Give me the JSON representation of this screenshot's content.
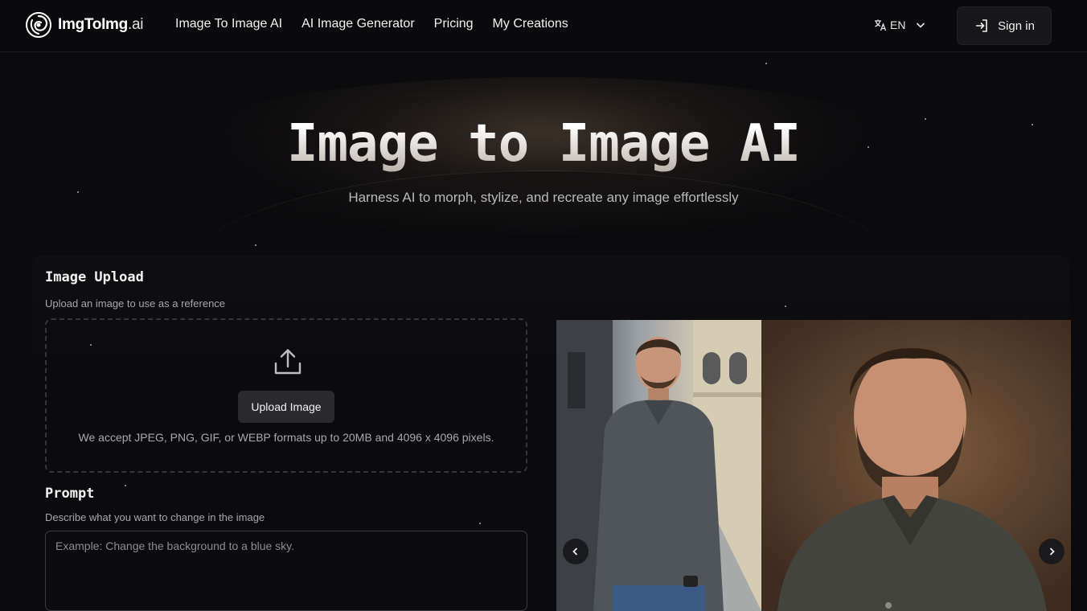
{
  "header": {
    "logo_name": "ImgToImg",
    "logo_tld": ".ai",
    "nav": [
      {
        "label": "Image To Image AI"
      },
      {
        "label": "AI Image Generator"
      },
      {
        "label": "Pricing"
      },
      {
        "label": "My Creations"
      }
    ],
    "language": "EN",
    "signin_label": "Sign in"
  },
  "hero": {
    "title": "Image to Image AI",
    "subtitle": "Harness AI to morph, stylize, and recreate any image effortlessly"
  },
  "upload": {
    "title": "Image Upload",
    "description": "Upload an image to use as a reference",
    "button_label": "Upload Image",
    "accept_text": "We accept JPEG, PNG, GIF, or WEBP formats up to 20MB and 4096 x 4096 pixels."
  },
  "prompt": {
    "title": "Prompt",
    "description": "Describe what you want to change in the image",
    "placeholder": "Example: Change the background to a blue sky.",
    "value": ""
  },
  "carousel": {
    "prev_icon": "chevron-left-icon",
    "next_icon": "chevron-right-icon"
  },
  "colors": {
    "background": "#0b0b0d",
    "header": "#0a0a0c",
    "button": "#2a2a2e",
    "text": "#f2f2f2",
    "muted": "#a7a7ab"
  }
}
